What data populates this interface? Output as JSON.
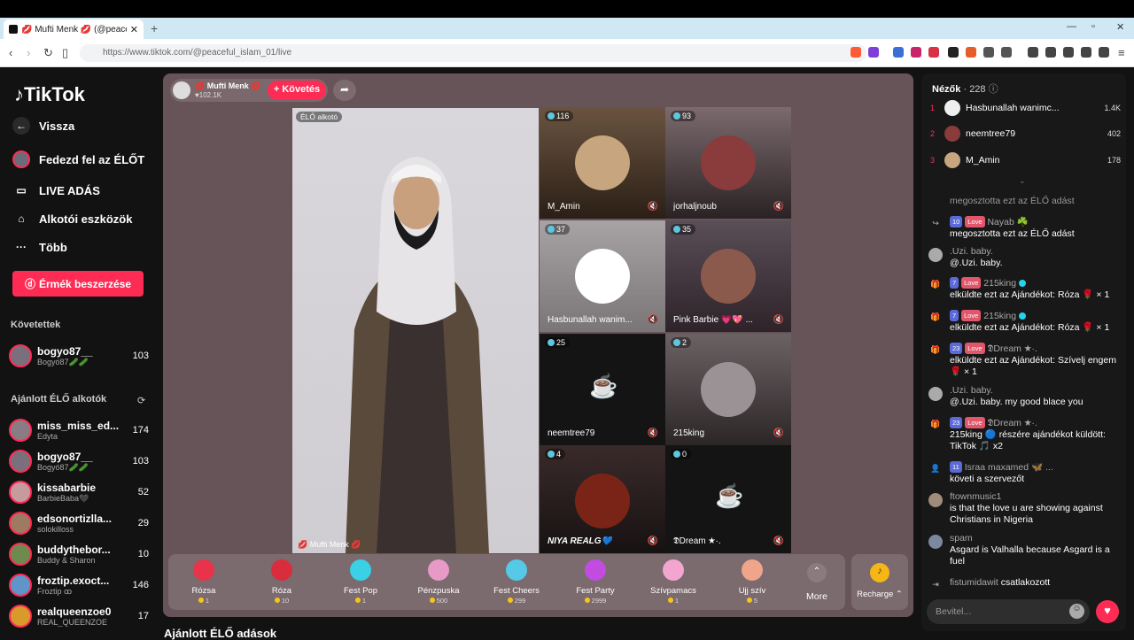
{
  "browser": {
    "tab_title": "💋 Mufti Menk 💋 (@peacef",
    "url": "https://www.tiktok.com/@peaceful_islam_01/live"
  },
  "sidebar": {
    "logo": "TikTok",
    "nav": [
      {
        "label": "Vissza",
        "icon": "arrow-left-icon"
      },
      {
        "label": "Fedezd fel az ÉLŐT",
        "icon": "avatar-icon"
      },
      {
        "label": "LIVE ADÁS",
        "icon": "video-icon"
      },
      {
        "label": "Alkotói eszközök",
        "icon": "lightbulb-icon"
      },
      {
        "label": "Több",
        "icon": "more-icon"
      }
    ],
    "coin_button": "Érmék beszerzése",
    "following_header": "Követettek",
    "following": [
      {
        "name": "bogyo87__",
        "sub": "Bogyó87🥒🥒",
        "count": "103"
      }
    ],
    "recommended_header": "Ajánlott ÉLŐ alkotók",
    "recommended": [
      {
        "name": "miss_miss_ed...",
        "sub": "Edyta",
        "count": "174"
      },
      {
        "name": "bogyo87__",
        "sub": "Bogyó87🥒🥒",
        "count": "103"
      },
      {
        "name": "kissabarbie",
        "sub": "BarbieBaba🖤",
        "count": "52"
      },
      {
        "name": "edsonortizlla...",
        "sub": "solokilloss",
        "count": "29"
      },
      {
        "name": "buddythebor...",
        "sub": "Buddy & Sharon",
        "count": "10"
      },
      {
        "name": "froztip.exoct...",
        "sub": "Froztip ꝏ",
        "count": "146"
      },
      {
        "name": "realqueenzoe0",
        "sub": "REAL_QUEENZOE",
        "count": "17"
      }
    ]
  },
  "host": {
    "name": "💋 Mufti Menk 💋",
    "likes": "♥102.1K",
    "follow_label": "+ Követés",
    "creator_label": "ÉLŐ alkotó",
    "video_name": "💋 Mufti Menk 💋"
  },
  "guests": [
    {
      "count": "116",
      "name": "M_Amin"
    },
    {
      "count": "93",
      "name": "jorhaljnoub"
    },
    {
      "count": "37",
      "name": "Hasbunallah wanim..."
    },
    {
      "count": "35",
      "name": "Pink Barbie 💗💖 ..."
    },
    {
      "count": "25",
      "name": "neemtree79"
    },
    {
      "count": "2",
      "name": "215king"
    },
    {
      "count": "4",
      "name": "NIYA REALG💙"
    },
    {
      "count": "0",
      "name": "𝕯Dream ★·."
    }
  ],
  "gifts": [
    {
      "name": "Rózsa",
      "price": "1",
      "color": "#e8334a"
    },
    {
      "name": "Róza",
      "price": "10",
      "color": "#d92d3e"
    },
    {
      "name": "Fest Pop",
      "price": "1",
      "color": "#3ad0e5"
    },
    {
      "name": "Pénzpuska",
      "price": "500",
      "color": "#e79ac6"
    },
    {
      "name": "Fest Cheers",
      "price": "299",
      "color": "#56c9e6"
    },
    {
      "name": "Fest Party",
      "price": "2999",
      "color": "#c24be0"
    },
    {
      "name": "Szívpamacs",
      "price": "1",
      "color": "#f2a6cf"
    },
    {
      "name": "Ujj szív",
      "price": "5",
      "color": "#f0a58a"
    }
  ],
  "gift_more": "More",
  "recharge": "Recharge",
  "bottom_title": "Ajánlott ÉLŐ adások",
  "viewers": {
    "title": "Nézők",
    "count": "· 228",
    "list": [
      {
        "rank": "1",
        "name": "Hasbunallah wanimc...",
        "score": "1.4K"
      },
      {
        "rank": "2",
        "name": "neemtree79",
        "score": "402"
      },
      {
        "rank": "3",
        "name": "M_Amin",
        "score": "178"
      }
    ]
  },
  "chat": {
    "c0": "megosztotta ezt az ÉLŐ adást",
    "c1_lvl": "10",
    "c1_badge": "Love",
    "c1_who": "Nayab ☘️",
    "c1_text": "megosztotta ezt az ÉLŐ adást",
    "c2_who": ".Uzi. baby.",
    "c2_text": "@.Uzi. baby.",
    "c3_lvl": "7",
    "c3_badge": "Love",
    "c3_who": "215king",
    "c3_text": "elküldte ezt az Ajándékot: Róza 🌹 × 1",
    "c4_lvl": "7",
    "c4_badge": "Love",
    "c4_who": "215king",
    "c4_text": "elküldte ezt az Ajándékot: Róza 🌹 × 1",
    "c5_lvl": "23",
    "c5_badge": "Love",
    "c5_who": "𝕯Dream ★·.",
    "c5_text": "elküldte ezt az Ajándékot: Szívelj engem 🌹 × 1",
    "c6_who": ".Uzi. baby.",
    "c6_text": "@.Uzi. baby. my good blace you",
    "c7_lvl": "23",
    "c7_badge": "Love",
    "c7_who": "𝕯Dream ★·.",
    "c7_text": "215king 🔵 részére ajándékot küldött: TikTok 🎵 x2",
    "c8_lvl": "11",
    "c8_who": "Israa maxamed 🦋 ...",
    "c8_text": "követi a szervezőt",
    "c9_who": "ftownmusic1",
    "c9_text": "is that the love u are showing against Christians in Nigeria",
    "c10_who": "spam",
    "c10_text": "Asgard is Valhalla because Asgard is a fuel",
    "c11_who": "fistumidawit",
    "c11_text": "csatlakozott"
  },
  "input_placeholder": "Bevitel...",
  "colors": {
    "accent": "#fe2c55",
    "stage_bg": "#665459",
    "panel_bg": "#181818"
  }
}
